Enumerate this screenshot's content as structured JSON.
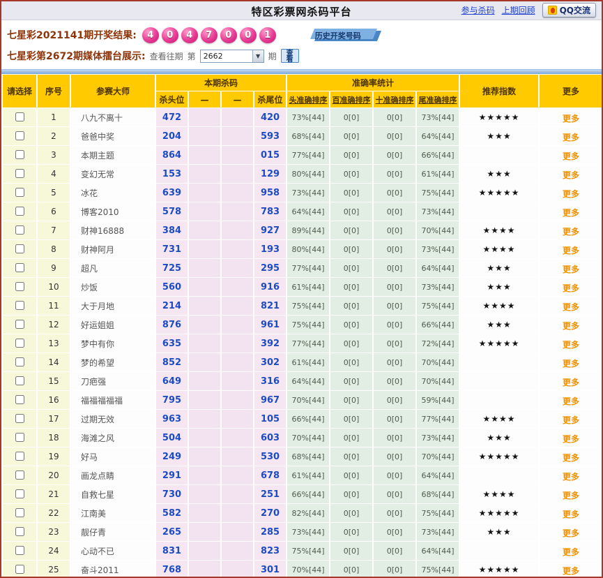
{
  "page": {
    "title": "特区彩票网杀码平台",
    "nav": {
      "join_label": "参与杀码",
      "review_label": "上期回顾",
      "qq_label": "QQ交流"
    },
    "draw": {
      "label": "七星彩2021141期开奖结果:",
      "balls": [
        "4",
        "0",
        "4",
        "7",
        "0",
        "0",
        "1"
      ],
      "history_label": "历史开奖号码"
    },
    "control": {
      "label": "七星彩第2672期媒体擂台展示:",
      "view_past_label": "查看往期",
      "di_label": "第",
      "period_value": "2662",
      "qi_label": "期",
      "view_button_label": "查看"
    },
    "colors": {
      "header_gold": "#FFCB00",
      "ball_pink": "#D6277E",
      "kill_blue": "#1D4CC2",
      "more_orange": "#F09200",
      "border_red": "#A6382B"
    }
  },
  "table": {
    "headers": {
      "select": "请选择",
      "index": "序号",
      "master": "参赛大师",
      "kill_group": "本期杀码",
      "kill_head": "杀头位",
      "dash1": "—",
      "dash2": "—",
      "kill_tail": "杀尾位",
      "acc_group": "准确率统计",
      "acc_head": "头准确排序",
      "acc_bai": "百准确排序",
      "acc_shi": "十准确排序",
      "acc_tail": "尾准确排序",
      "stars": "推荐指数",
      "more": "更多"
    },
    "more_label": "更多",
    "rows": [
      {
        "num": "1",
        "name": "八九不离十",
        "head": "472",
        "tail": "420",
        "acc_head": "73%[44]",
        "acc_bai": "0[0]",
        "acc_shi": "0[0]",
        "acc_tail": "73%[44]",
        "stars": "★★★★★"
      },
      {
        "num": "2",
        "name": "爸爸中奖",
        "head": "204",
        "tail": "593",
        "acc_head": "68%[44]",
        "acc_bai": "0[0]",
        "acc_shi": "0[0]",
        "acc_tail": "64%[44]",
        "stars": "★★★"
      },
      {
        "num": "3",
        "name": "本期主题",
        "head": "864",
        "tail": "015",
        "acc_head": "77%[44]",
        "acc_bai": "0[0]",
        "acc_shi": "0[0]",
        "acc_tail": "66%[44]",
        "stars": ""
      },
      {
        "num": "4",
        "name": "变幻无常",
        "head": "153",
        "tail": "129",
        "acc_head": "80%[44]",
        "acc_bai": "0[0]",
        "acc_shi": "0[0]",
        "acc_tail": "61%[44]",
        "stars": "★★★"
      },
      {
        "num": "5",
        "name": "冰花",
        "head": "639",
        "tail": "958",
        "acc_head": "73%[44]",
        "acc_bai": "0[0]",
        "acc_shi": "0[0]",
        "acc_tail": "75%[44]",
        "stars": "★★★★★"
      },
      {
        "num": "6",
        "name": "博客2010",
        "head": "578",
        "tail": "783",
        "acc_head": "64%[44]",
        "acc_bai": "0[0]",
        "acc_shi": "0[0]",
        "acc_tail": "73%[44]",
        "stars": ""
      },
      {
        "num": "7",
        "name": "财神16888",
        "head": "384",
        "tail": "927",
        "acc_head": "89%[44]",
        "acc_bai": "0[0]",
        "acc_shi": "0[0]",
        "acc_tail": "70%[44]",
        "stars": "★★★★"
      },
      {
        "num": "8",
        "name": "财神阿月",
        "head": "731",
        "tail": "193",
        "acc_head": "80%[44]",
        "acc_bai": "0[0]",
        "acc_shi": "0[0]",
        "acc_tail": "73%[44]",
        "stars": "★★★★"
      },
      {
        "num": "9",
        "name": "超凡",
        "head": "725",
        "tail": "295",
        "acc_head": "77%[44]",
        "acc_bai": "0[0]",
        "acc_shi": "0[0]",
        "acc_tail": "64%[44]",
        "stars": "★★★"
      },
      {
        "num": "10",
        "name": "炒饭",
        "head": "560",
        "tail": "916",
        "acc_head": "61%[44]",
        "acc_bai": "0[0]",
        "acc_shi": "0[0]",
        "acc_tail": "73%[44]",
        "stars": "★★★"
      },
      {
        "num": "11",
        "name": "大于月地",
        "head": "214",
        "tail": "821",
        "acc_head": "75%[44]",
        "acc_bai": "0[0]",
        "acc_shi": "0[0]",
        "acc_tail": "75%[44]",
        "stars": "★★★★"
      },
      {
        "num": "12",
        "name": "好运姐姐",
        "head": "876",
        "tail": "961",
        "acc_head": "75%[44]",
        "acc_bai": "0[0]",
        "acc_shi": "0[0]",
        "acc_tail": "66%[44]",
        "stars": "★★★"
      },
      {
        "num": "13",
        "name": "梦中有你",
        "head": "635",
        "tail": "392",
        "acc_head": "77%[44]",
        "acc_bai": "0[0]",
        "acc_shi": "0[0]",
        "acc_tail": "72%[44]",
        "stars": "★★★★★"
      },
      {
        "num": "14",
        "name": "梦的希望",
        "head": "852",
        "tail": "302",
        "acc_head": "61%[44]",
        "acc_bai": "0[0]",
        "acc_shi": "0[0]",
        "acc_tail": "70%[44]",
        "stars": ""
      },
      {
        "num": "15",
        "name": "刀疤强",
        "head": "649",
        "tail": "316",
        "acc_head": "64%[44]",
        "acc_bai": "0[0]",
        "acc_shi": "0[0]",
        "acc_tail": "70%[44]",
        "stars": ""
      },
      {
        "num": "16",
        "name": "福福福福福",
        "head": "795",
        "tail": "967",
        "acc_head": "70%[44]",
        "acc_bai": "0[0]",
        "acc_shi": "0[0]",
        "acc_tail": "59%[44]",
        "stars": ""
      },
      {
        "num": "17",
        "name": "过期无效",
        "head": "963",
        "tail": "105",
        "acc_head": "66%[44]",
        "acc_bai": "0[0]",
        "acc_shi": "0[0]",
        "acc_tail": "77%[44]",
        "stars": "★★★★"
      },
      {
        "num": "18",
        "name": "海滩之风",
        "head": "504",
        "tail": "603",
        "acc_head": "70%[44]",
        "acc_bai": "0[0]",
        "acc_shi": "0[0]",
        "acc_tail": "73%[44]",
        "stars": "★★★"
      },
      {
        "num": "19",
        "name": "好马",
        "head": "249",
        "tail": "530",
        "acc_head": "68%[44]",
        "acc_bai": "0[0]",
        "acc_shi": "0[0]",
        "acc_tail": "70%[44]",
        "stars": "★★★★★"
      },
      {
        "num": "20",
        "name": "画龙点睛",
        "head": "291",
        "tail": "678",
        "acc_head": "61%[44]",
        "acc_bai": "0[0]",
        "acc_shi": "0[0]",
        "acc_tail": "64%[44]",
        "stars": ""
      },
      {
        "num": "21",
        "name": "自救七星",
        "head": "730",
        "tail": "251",
        "acc_head": "66%[44]",
        "acc_bai": "0[0]",
        "acc_shi": "0[0]",
        "acc_tail": "68%[44]",
        "stars": "★★★★"
      },
      {
        "num": "22",
        "name": "江南美",
        "head": "582",
        "tail": "270",
        "acc_head": "82%[44]",
        "acc_bai": "0[0]",
        "acc_shi": "0[0]",
        "acc_tail": "75%[44]",
        "stars": "★★★★★"
      },
      {
        "num": "23",
        "name": "靓仔青",
        "head": "265",
        "tail": "285",
        "acc_head": "73%[44]",
        "acc_bai": "0[0]",
        "acc_shi": "0[0]",
        "acc_tail": "73%[44]",
        "stars": "★★★"
      },
      {
        "num": "24",
        "name": "心动不已",
        "head": "831",
        "tail": "823",
        "acc_head": "75%[44]",
        "acc_bai": "0[0]",
        "acc_shi": "0[0]",
        "acc_tail": "64%[44]",
        "stars": ""
      },
      {
        "num": "25",
        "name": "奋斗2011",
        "head": "768",
        "tail": "301",
        "acc_head": "70%[44]",
        "acc_bai": "0[0]",
        "acc_shi": "0[0]",
        "acc_tail": "75%[44]",
        "stars": "★★★★★"
      }
    ]
  }
}
